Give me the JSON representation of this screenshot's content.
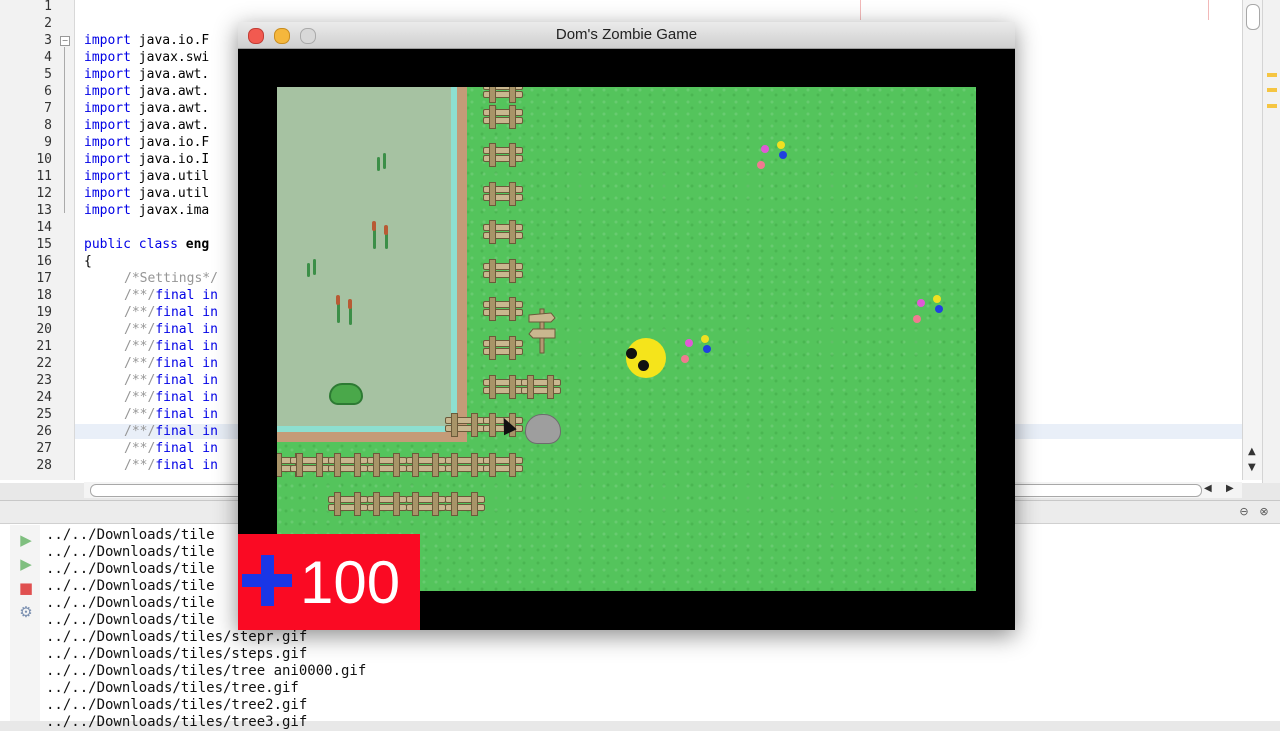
{
  "editor": {
    "line_numbers": [
      "1",
      "2",
      "3",
      "4",
      "5",
      "6",
      "7",
      "8",
      "9",
      "10",
      "11",
      "12",
      "13",
      "14",
      "15",
      "16",
      "17",
      "18",
      "19",
      "20",
      "21",
      "22",
      "23",
      "24",
      "25",
      "26",
      "27",
      "28"
    ],
    "imports": [
      "java.io.F",
      "javax.swi",
      "java.awt.",
      "java.awt.",
      "java.awt.",
      "java.awt.",
      "java.io.F",
      "java.io.I",
      "java.util",
      "java.util",
      "javax.ima"
    ],
    "class_decl": "eng",
    "settings_comment": "/*Settings*/",
    "final_prefix": "/**/",
    "final_lines": [
      "final in",
      "final in",
      "final in",
      "final in",
      "final in",
      "final in",
      "final in",
      "final in",
      "final in",
      "final in",
      "final in"
    ],
    "open_brace": "{",
    "keyword_import": "import",
    "keyword_public": "public",
    "keyword_class": "class"
  },
  "output": {
    "lines": [
      "../../Downloads/tile",
      "../../Downloads/tile",
      "../../Downloads/tile",
      "../../Downloads/tile",
      "../../Downloads/tile",
      "../../Downloads/tile",
      "../../Downloads/tiles/stepr.gif",
      "../../Downloads/tiles/steps.gif",
      "../../Downloads/tiles/tree ani0000.gif",
      "../../Downloads/tiles/tree.gif",
      "../../Downloads/tiles/tree2.gif",
      "../../Downloads/tiles/tree3.gif"
    ]
  },
  "game": {
    "title": "Dom's Zombie Game",
    "score": "100",
    "colors": {
      "grass": "#54c45c",
      "score_bg": "#fa0a23",
      "plus": "#1a36e6",
      "player": "#f5e41b"
    }
  },
  "icons": [
    "rerun-icon",
    "rerun-forward-icon",
    "stop-icon",
    "settings-icon",
    "close-icon",
    "restore-icon",
    "minimize-icon",
    "maximize-icon"
  ]
}
